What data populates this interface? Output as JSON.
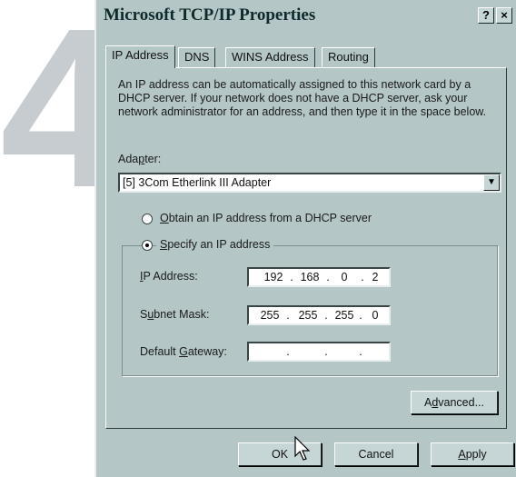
{
  "step_number": "4",
  "window": {
    "title": "Microsoft TCP/IP Properties",
    "help_button": "?",
    "close_button": "×"
  },
  "tabs": [
    {
      "label": "IP Address",
      "active": true
    },
    {
      "label": "DNS",
      "active": false
    },
    {
      "label": "WINS Address",
      "active": false
    },
    {
      "label": "Routing",
      "active": false
    }
  ],
  "description": "An IP address can be automatically assigned to this network card by a DHCP server.  If your network does not have a DHCP server, ask your network administrator for an address, and then type it in the space below.",
  "adapter": {
    "label_pre": "Ada",
    "label_hot": "p",
    "label_post": "ter:",
    "selected": "[5] 3Com Etherlink III Adapter"
  },
  "radio_dhcp": {
    "hot": "O",
    "rest": "btain an IP address from a DHCP server",
    "selected": false
  },
  "radio_specify": {
    "hot": "S",
    "rest": "pecify an IP address",
    "selected": true
  },
  "fields": {
    "ip_address": {
      "label_hot": "I",
      "label_rest": "P Address:",
      "octets": [
        "192",
        "168",
        "0",
        "2"
      ]
    },
    "subnet_mask": {
      "label_pre": "S",
      "label_hot": "u",
      "label_rest": "bnet Mask:",
      "octets": [
        "255",
        "255",
        "255",
        "0"
      ]
    },
    "gateway": {
      "label_pre": "Default ",
      "label_hot": "G",
      "label_rest": "ateway:",
      "octets": [
        "",
        "",
        "",
        ""
      ]
    }
  },
  "buttons": {
    "advanced_pre": "A",
    "advanced_hot": "d",
    "advanced_rest": "vanced...",
    "ok": "OK",
    "cancel": "Cancel",
    "apply_hot": "A",
    "apply_rest": "pply"
  },
  "colors": {
    "dialog_bg": "#b4c6c6",
    "step_number": "#c6cccf"
  },
  "icons": {
    "cursor": "arrow-pointer-icon",
    "dropdown": "chevron-down-icon"
  }
}
